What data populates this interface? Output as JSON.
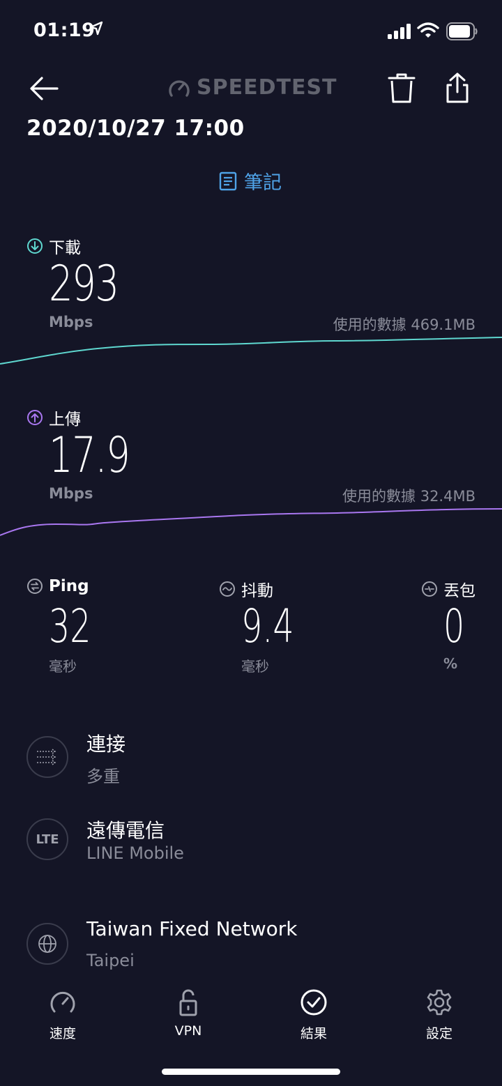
{
  "status_bar": {
    "time": "01:19"
  },
  "header": {
    "logo_text": "SPEEDTEST",
    "datetime": "2020/10/27 17:00",
    "notes_label": "筆記"
  },
  "download": {
    "label": "下載",
    "value": "293",
    "unit": "Mbps",
    "usage": "使用的數據 469.1MB",
    "color": "#5fd8d0"
  },
  "upload": {
    "label": "上傳",
    "value": "17.9",
    "unit": "Mbps",
    "usage": "使用的數據 32.4MB",
    "color": "#a977f0"
  },
  "stats": {
    "ping": {
      "label": "Ping",
      "value": "32",
      "unit": "毫秒"
    },
    "jitter": {
      "label": "抖動",
      "value": "9.4",
      "unit": "毫秒"
    },
    "loss": {
      "label": "丟包",
      "value": "0",
      "unit": "%"
    }
  },
  "info": {
    "connection": {
      "title": "連接",
      "sub": "多重",
      "icon": "connections-icon"
    },
    "carrier": {
      "title": "遠傳電信",
      "sub": "LINE Mobile",
      "icon_text": "LTE"
    },
    "server": {
      "title": "Taiwan Fixed Network",
      "sub": "Taipei",
      "icon": "globe-icon"
    }
  },
  "tabbar": {
    "speed": "速度",
    "vpn": "VPN",
    "results": "結果",
    "settings": "設定"
  },
  "colors": {
    "background": "#141526",
    "accent_blue": "#4fa3e8",
    "muted": "#8a8c99"
  }
}
